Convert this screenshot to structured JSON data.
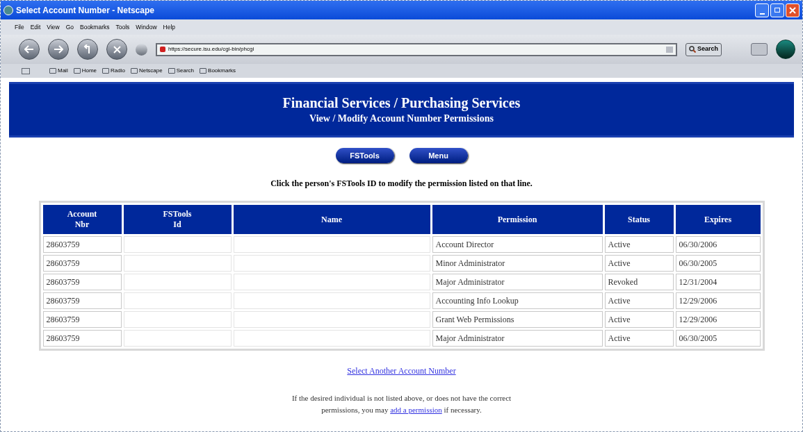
{
  "window": {
    "title": "Select Account Number - Netscape"
  },
  "menu": [
    "File",
    "Edit",
    "View",
    "Go",
    "Bookmarks",
    "Tools",
    "Window",
    "Help"
  ],
  "address": {
    "value": "https://secure.isu.edu/cgi-bin/phcgi"
  },
  "search_button": "Search",
  "personal_toolbar": [
    "Mail",
    "Home",
    "Radio",
    "Netscape",
    "Search",
    "Bookmarks"
  ],
  "header": {
    "title": "Financial Services / Purchasing Services",
    "subtitle": "View / Modify Account Number Permissions"
  },
  "nav_buttons": [
    "FSTools",
    "Menu"
  ],
  "instruction": "Click the person's FSTools ID to modify the permission listed on that line.",
  "table": {
    "columns": [
      "Account\nNbr",
      "FSTools\nId",
      "Name",
      "Permission",
      "Status",
      "Expires"
    ],
    "rows": [
      {
        "account": "28603759",
        "permission": "Account Director",
        "status": "Active",
        "expires": "06/30/2006"
      },
      {
        "account": "28603759",
        "permission": "Minor Administrator",
        "status": "Active",
        "expires": "06/30/2005"
      },
      {
        "account": "28603759",
        "permission": "Major Administrator",
        "status": "Revoked",
        "expires": "12/31/2004"
      },
      {
        "account": "28603759",
        "permission": "Accounting Info Lookup",
        "status": "Active",
        "expires": "12/29/2006"
      },
      {
        "account": "28603759",
        "permission": "Grant Web Permissions",
        "status": "Active",
        "expires": "12/29/2006"
      },
      {
        "account": "28603759",
        "permission": "Major Administrator",
        "status": "Active",
        "expires": "06/30/2005"
      }
    ]
  },
  "select_link": "Select Another Account Number",
  "help": {
    "before": "If the desired individual is not listed above, or does not have the correct permissions, you may",
    "link": "add a permission",
    "after": "if necessary."
  }
}
